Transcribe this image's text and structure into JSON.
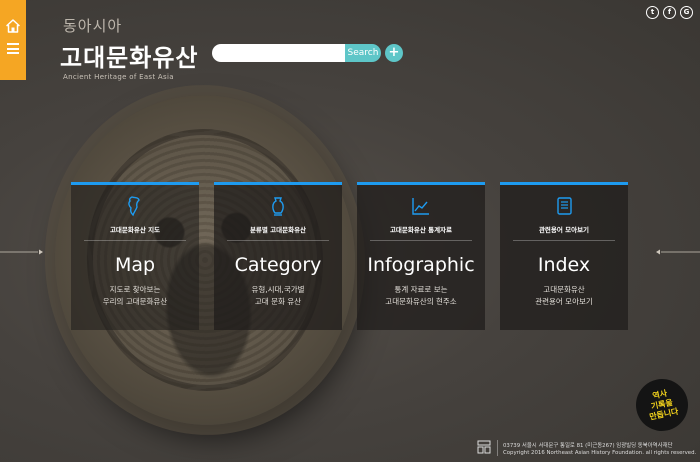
{
  "header": {
    "subtitle": "동아시아",
    "title": "고대문화유산",
    "english_title": "Ancient Heritage of East Asia"
  },
  "search": {
    "placeholder": "",
    "button_label": "Search",
    "add_label": "+"
  },
  "social": {
    "twitter": "t",
    "facebook": "f",
    "google": "G"
  },
  "cards": [
    {
      "small_label": "고대문화유산 지도",
      "title": "Map",
      "desc1": "지도로 찾아보는",
      "desc2": "우리의 고대문화유산",
      "icon": "korea-map-icon"
    },
    {
      "small_label": "분류별 고대문화유산",
      "title": "Category",
      "desc1": "유형,시대,국가별",
      "desc2": "고대 문화 유산",
      "icon": "vase-icon"
    },
    {
      "small_label": "고대문화유산 통계자료",
      "title": "Infographic",
      "desc1": "통계 자료로 보는",
      "desc2": "고대문화유산의 현주소",
      "icon": "line-chart-icon"
    },
    {
      "small_label": "관련용어 모아보기",
      "title": "Index",
      "desc1": "고대문화유산",
      "desc2": "관련용어 모아보기",
      "icon": "notebook-icon"
    }
  ],
  "stamp": {
    "line1": "역사",
    "line2": "기록을",
    "line3": "만듭니다"
  },
  "footer": {
    "address": "03739 서울시 서대문구 통일로 81 (미근동267) 임광빌딩 동북아역사재단",
    "copyright": "Copyright 2016 Northeast Asian History Foundation. all rights reserved."
  },
  "colors": {
    "accent_orange": "#f5a623",
    "card_top_blue": "#1e9bf0",
    "search_teal": "#5ec6c8"
  }
}
